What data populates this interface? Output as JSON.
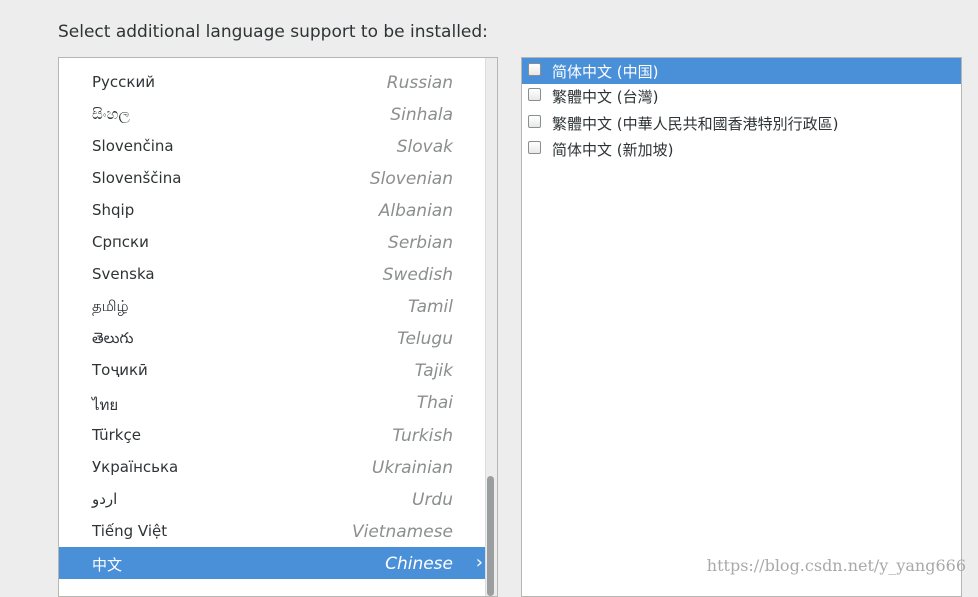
{
  "heading": "Select additional language support to be installed:",
  "languages": [
    {
      "native": "Русский",
      "english": "Russian"
    },
    {
      "native": "සිංහල",
      "english": "Sinhala"
    },
    {
      "native": "Slovenčina",
      "english": "Slovak"
    },
    {
      "native": "Slovenščina",
      "english": "Slovenian"
    },
    {
      "native": "Shqip",
      "english": "Albanian"
    },
    {
      "native": "Српски",
      "english": "Serbian"
    },
    {
      "native": "Svenska",
      "english": "Swedish"
    },
    {
      "native": "தமிழ்",
      "english": "Tamil"
    },
    {
      "native": "తెలుగు",
      "english": "Telugu"
    },
    {
      "native": "Тоҷикӣ",
      "english": "Tajik"
    },
    {
      "native": "ไทย",
      "english": "Thai"
    },
    {
      "native": "Türkçe",
      "english": "Turkish"
    },
    {
      "native": "Українська",
      "english": "Ukrainian"
    },
    {
      "native": "اردو",
      "english": "Urdu"
    },
    {
      "native": "Tiếng Việt",
      "english": "Vietnamese"
    },
    {
      "native": "中文",
      "english": "Chinese",
      "selected": true
    }
  ],
  "locales": [
    {
      "label": "简体中文 (中国)",
      "checked": false,
      "selected": true
    },
    {
      "label": "繁體中文 (台灣)",
      "checked": false
    },
    {
      "label": "繁體中文 (中華人民共和國香港特別行政區)",
      "checked": false
    },
    {
      "label": "简体中文 (新加坡)",
      "checked": false
    }
  ],
  "chevron_icon": "chevron-right-icon",
  "colors": {
    "selection": "#4a90d9",
    "background": "#ededed"
  },
  "watermark": "https://blog.csdn.net/y_yang666"
}
